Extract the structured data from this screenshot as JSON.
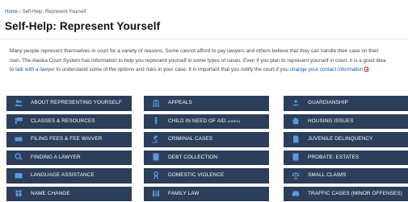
{
  "breadcrumb": {
    "home": "Home",
    "separator": "/",
    "current": "Self-Help: Represent Yourself"
  },
  "page": {
    "title": "Self-Help: Represent Yourself"
  },
  "intro": {
    "text_1": "Many people represent themselves in court for a variety of reasons. Some cannot afford to pay lawyers and others believe that they can handle their case on their own. The Alaska Court System has information to help you represent yourself in some types of cases. Even if you plan to represent yourself in court, it is a good idea to ",
    "link_1": "talk with a lawyer",
    "text_2": " to understand some of the options and risks in your case. It is important that you notify the court if you ",
    "link_2": "change your contact information",
    "text_3": "."
  },
  "colors": {
    "tile_bg": "#2c3e5a",
    "icon": "#5a9bd5",
    "link": "#1a5aa0"
  },
  "tiles": {
    "col1": [
      {
        "label": "ABOUT REPRESENTING YOURSELF",
        "icon": "users-icon"
      },
      {
        "label": "CLASSES & RESOURCES",
        "icon": "presentation-icon"
      },
      {
        "label": "FILING FEES & FEE WAIVER",
        "icon": "money-icon"
      },
      {
        "label": "FINDING A LAWYER",
        "icon": "search-icon"
      },
      {
        "label": "LANGUAGE ASSISTANCE",
        "icon": "id-card-icon"
      },
      {
        "label": "NAME CHANGE",
        "icon": "people-icon"
      }
    ],
    "col2": [
      {
        "label": "APPEALS",
        "icon": "courthouse-icon"
      },
      {
        "label": "CHILD IN NEED OF AID",
        "label_small": "(VIDEO)",
        "icon": "child-icon"
      },
      {
        "label": "CRIMINAL CASES",
        "icon": "gavel-icon"
      },
      {
        "label": "DEBT COLLECTION",
        "icon": "calculator-icon"
      },
      {
        "label": "DOMESTIC VIOLENCE",
        "icon": "ribbon-icon"
      },
      {
        "label": "FAMILY LAW",
        "icon": "family-icon"
      }
    ],
    "col3": [
      {
        "label": "GUARDIANSHIP",
        "icon": "hands-icon"
      },
      {
        "label": "HOUSING ISSUES",
        "icon": "home-icon"
      },
      {
        "label": "JUVENILE DELINQUENCY",
        "icon": "document-icon"
      },
      {
        "label": "PROBATE: ESTATES",
        "icon": "will-icon"
      },
      {
        "label": "SMALL CLAIMS",
        "icon": "balance-icon"
      },
      {
        "label": "TRAFFIC CASES (MINOR OFFENSES)",
        "icon": "car-icon"
      }
    ]
  }
}
